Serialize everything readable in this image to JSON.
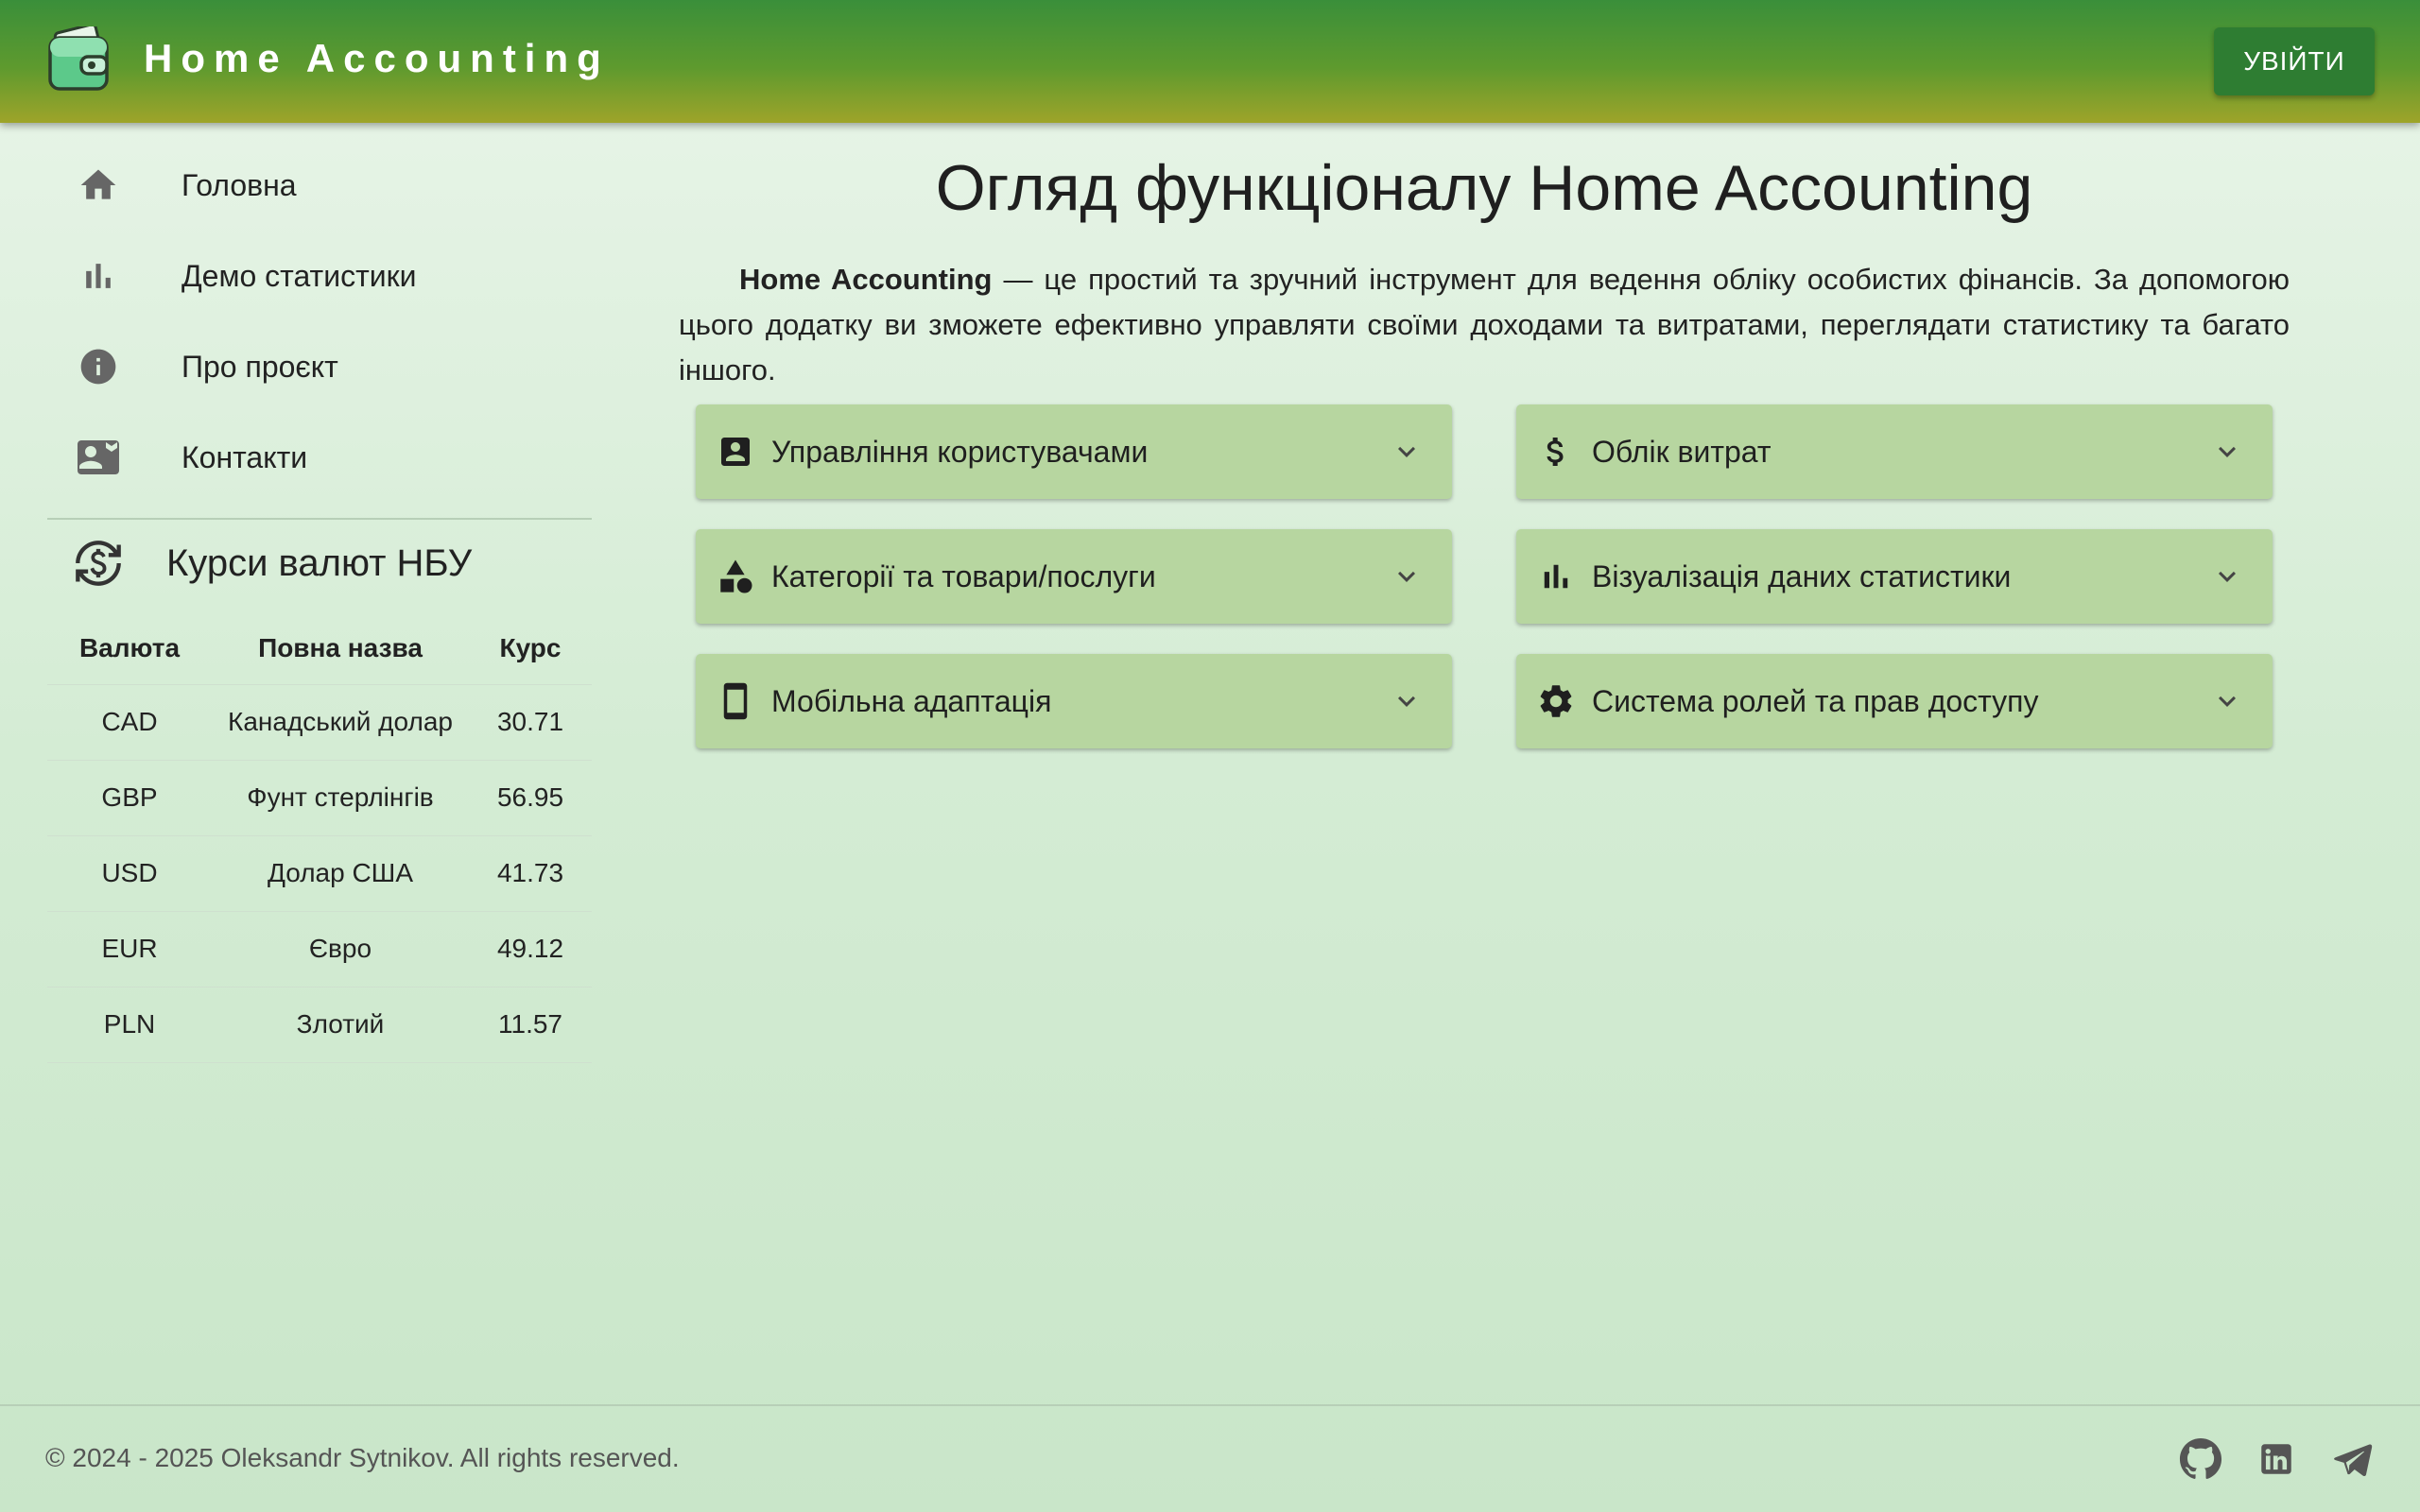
{
  "header": {
    "app_title": "Home Accounting",
    "login_label": "УВІЙТИ",
    "logo_icon": "wallet-icon"
  },
  "sidebar": {
    "items": [
      {
        "label": "Головна",
        "icon": "home-icon"
      },
      {
        "label": "Демо статистики",
        "icon": "bar-chart-icon"
      },
      {
        "label": "Про проєкт",
        "icon": "info-icon"
      },
      {
        "label": "Контакти",
        "icon": "contact-card-icon"
      }
    ],
    "rates": {
      "title": "Курси валют НБУ",
      "icon": "currency-exchange-icon",
      "columns": [
        "Валюта",
        "Повна назва",
        "Курс"
      ],
      "rows": [
        [
          "CAD",
          "Канадський долар",
          "30.71"
        ],
        [
          "GBP",
          "Фунт стерлінгів",
          "56.95"
        ],
        [
          "USD",
          "Долар США",
          "41.73"
        ],
        [
          "EUR",
          "Євро",
          "49.12"
        ],
        [
          "PLN",
          "Злотий",
          "11.57"
        ]
      ]
    }
  },
  "main": {
    "title": "Огляд функціоналу Home Accounting",
    "intro_bold": "Home Accounting",
    "intro_text": " — це простий та зручний інструмент для ведення обліку особистих фінансів. За допомогою цього додатку ви зможете ефективно управляти своїми доходами та витратами, переглядати статистику та багато іншого.",
    "features": [
      {
        "label": "Управління користувачами",
        "icon": "account-box-icon"
      },
      {
        "label": "Облік витрат",
        "icon": "dollar-icon"
      },
      {
        "label": "Категорії та товари/послуги",
        "icon": "shapes-icon"
      },
      {
        "label": "Візуалізація даних статистики",
        "icon": "bar-chart-icon"
      },
      {
        "label": "Мобільна адаптація",
        "icon": "smartphone-icon"
      },
      {
        "label": "Система ролей та прав доступу",
        "icon": "settings-gear-icon"
      }
    ]
  },
  "footer": {
    "copyright": "© 2024 - 2025 Oleksandr Sytnikov. All rights reserved.",
    "social": [
      "github-icon",
      "linkedin-icon",
      "telegram-icon"
    ]
  },
  "colors": {
    "header_top": "#3a8f3a",
    "header_bottom": "#9ea42a",
    "login_button": "#2e7d32",
    "accordion_bg": "#b7d6a0",
    "icon_gray": "#666666"
  }
}
